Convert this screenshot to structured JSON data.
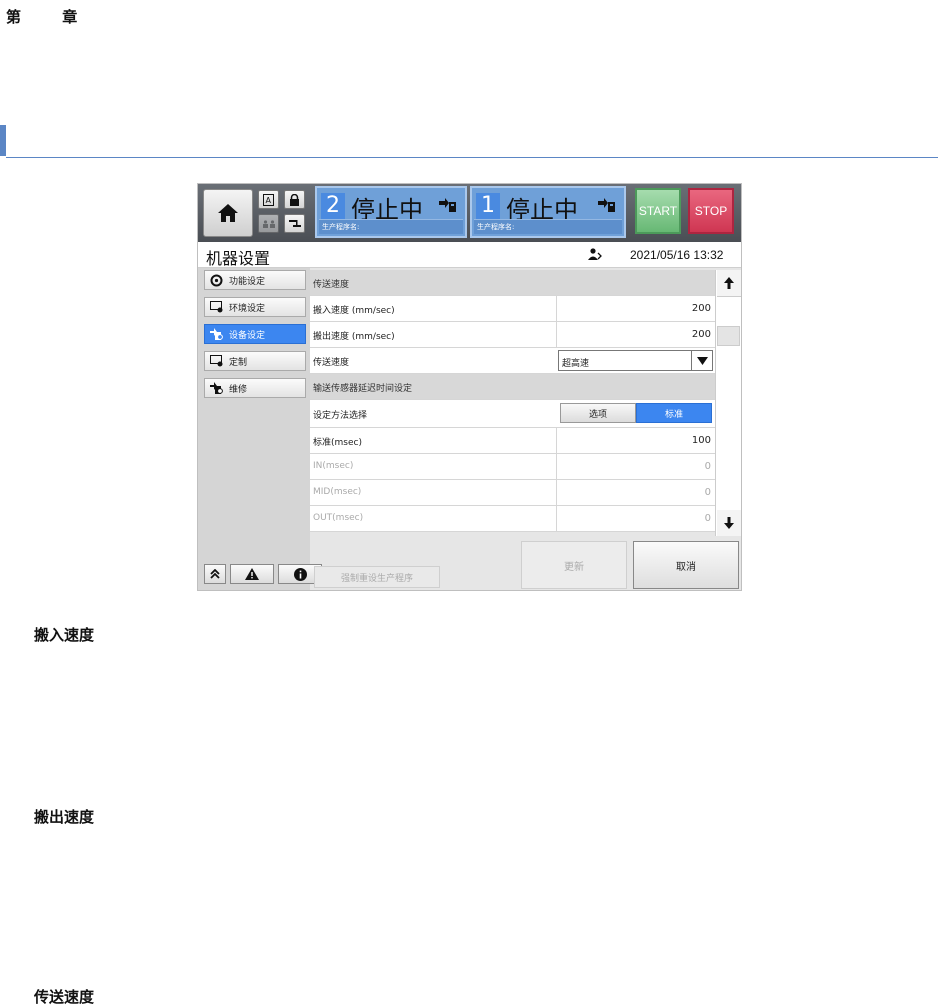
{
  "doc": {
    "chapter": "第 章",
    "headings": [
      "搬入速度",
      "搬出速度",
      "传送速度"
    ]
  },
  "screen": {
    "lanes": [
      {
        "number": "2",
        "status": "停止中",
        "program_label": "生产程序名:"
      },
      {
        "number": "1",
        "status": "停止中",
        "program_label": "生产程序名:"
      }
    ],
    "start_label": "START",
    "stop_label": "STOP",
    "page_title": "机器设置",
    "datetime": "2021/05/16 13:32",
    "sidebar": [
      {
        "label": "功能设定",
        "icon": "function-settings-icon"
      },
      {
        "label": "环境设定",
        "icon": "environment-settings-icon"
      },
      {
        "label": "设备设定",
        "icon": "device-settings-icon",
        "active": true
      },
      {
        "label": "定制",
        "icon": "custom-icon"
      },
      {
        "label": "维修",
        "icon": "maintenance-icon"
      }
    ],
    "rows": [
      {
        "type": "group",
        "label": "传送速度"
      },
      {
        "type": "value",
        "label": "搬入速度 (mm/sec)",
        "value": "200"
      },
      {
        "type": "value",
        "label": "搬出速度 (mm/sec)",
        "value": "200"
      },
      {
        "type": "select",
        "label": "传送速度",
        "value": "超高速"
      },
      {
        "type": "group",
        "label": "输送传感器延迟时间设定"
      },
      {
        "type": "segment",
        "label": "设定方法选择",
        "options": [
          "选项",
          "标准"
        ],
        "selected": "标准"
      },
      {
        "type": "value",
        "label": "标准(msec)",
        "value": "100"
      },
      {
        "type": "value",
        "label": "IN(msec)",
        "value": "0",
        "disabled": true
      },
      {
        "type": "value",
        "label": "MID(msec)",
        "value": "0",
        "disabled": true
      },
      {
        "type": "value",
        "label": "OUT(msec)",
        "value": "0",
        "disabled": true
      }
    ],
    "force_reset_label": "强制重设生产程序",
    "update_label": "更新",
    "cancel_label": "取消",
    "accent_color": "#3c86f0",
    "start_color": "#67b874",
    "stop_color": "#cf3652"
  }
}
